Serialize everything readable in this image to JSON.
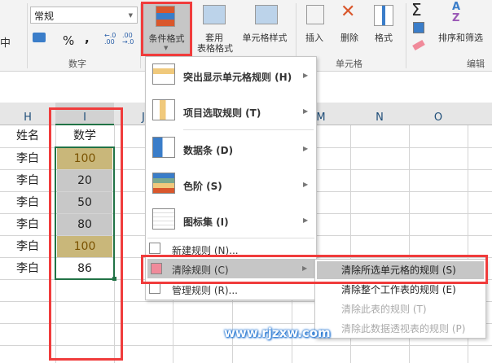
{
  "ribbon": {
    "merge_fragment": "中",
    "number_format": "常规",
    "percent": "%",
    "comma": ",",
    "inc_decimal": "←.0 .00",
    "dec_decimal": ".00 →.0",
    "number_group": "数字",
    "conditional_format": "条件格式",
    "table_format_1": "套用",
    "table_format_2": "表格格式",
    "cell_style": "单元格样式",
    "insert": "插入",
    "delete": "删除",
    "format": "格式",
    "cells_group": "单元格",
    "sort_filter": "排序和筛选",
    "edit_group": "编辑",
    "sigma": "Σ"
  },
  "columns": [
    "H",
    "I",
    "J",
    "M",
    "N",
    "O"
  ],
  "table": {
    "header": [
      "姓名",
      "数学"
    ],
    "rows": [
      [
        "李白",
        "100"
      ],
      [
        "李白",
        "20"
      ],
      [
        "李白",
        "50"
      ],
      [
        "李白",
        "80"
      ],
      [
        "李白",
        "100"
      ],
      [
        "李白",
        "86"
      ]
    ]
  },
  "colors": {
    "highlight": "#c9b77a",
    "gray": "#c8c8c8",
    "accent": "#217346",
    "red": "#f03c3c"
  },
  "menu": {
    "items": [
      {
        "label": "突出显示单元格规则 (H)",
        "icon": "highlight-rules-icon"
      },
      {
        "label": "项目选取规则 (T)",
        "icon": "top-bottom-icon"
      },
      {
        "label": "数据条 (D)",
        "icon": "data-bars-icon"
      },
      {
        "label": "色阶 (S)",
        "icon": "color-scales-icon"
      },
      {
        "label": "图标集 (I)",
        "icon": "icon-sets-icon"
      }
    ],
    "new_rule": "新建规则 (N)...",
    "clear_rules": "清除规则 (C)",
    "manage_rules": "管理规则 (R)..."
  },
  "submenu": [
    {
      "label": "清除所选单元格的规则 (S)",
      "enabled": true
    },
    {
      "label": "清除整个工作表的规则 (E)",
      "enabled": true
    },
    {
      "label": "清除此表的规则 (T)",
      "enabled": false
    },
    {
      "label": "清除此数据透视表的规则 (P)",
      "enabled": false
    }
  ],
  "watermark": "www.rjzxw.com"
}
